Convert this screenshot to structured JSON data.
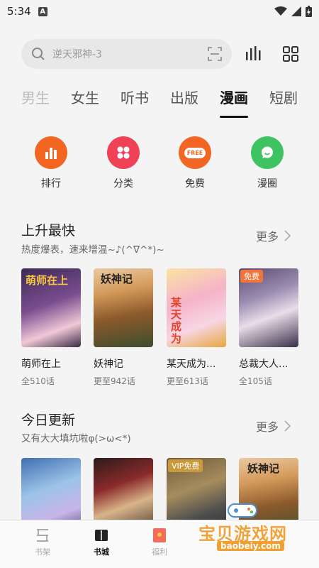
{
  "status": {
    "time": "5:34",
    "a_label": "A"
  },
  "search": {
    "placeholder": "逆天邪神-3"
  },
  "tabs": [
    {
      "label": "男生"
    },
    {
      "label": "女生"
    },
    {
      "label": "听书"
    },
    {
      "label": "出版"
    },
    {
      "label": "漫画"
    },
    {
      "label": "短剧"
    }
  ],
  "active_tab": "漫画",
  "quick_actions": [
    {
      "label": "排行",
      "icon": "bar-chart-icon",
      "color": "#f26522"
    },
    {
      "label": "分类",
      "icon": "grid-icon",
      "color": "#ef4257"
    },
    {
      "label": "免费",
      "icon": "free-icon",
      "icon_text": "FREE",
      "color": "#f26522"
    },
    {
      "label": "漫圈",
      "icon": "chat-icon",
      "color": "#3ec362"
    }
  ],
  "sections": [
    {
      "title": "上升最快",
      "subtitle": "热度爆表，速来增温~♪(^∇^*)~",
      "more": "更多",
      "books": [
        {
          "title": "萌师在上",
          "meta": "全510话",
          "cover_text": "萌师在上",
          "badge": ""
        },
        {
          "title": "妖神记",
          "meta": "更至942话",
          "cover_text": "妖神记",
          "badge": ""
        },
        {
          "title": "某天成为...",
          "meta": "更至613话",
          "cover_text": "某天成为",
          "badge": ""
        },
        {
          "title": "总裁大人...",
          "meta": "全105话",
          "cover_text": "",
          "badge": "免费"
        }
      ]
    },
    {
      "title": "今日更新",
      "subtitle": "又有大大填坑啦φ(>ω<*)",
      "more": "更多",
      "books": [
        {
          "title": "",
          "meta": "",
          "cover_text": "",
          "badge": ""
        },
        {
          "title": "",
          "meta": "",
          "cover_text": "",
          "badge": ""
        },
        {
          "title": "",
          "meta": "",
          "cover_text": "",
          "badge": "VIP免费"
        },
        {
          "title": "",
          "meta": "",
          "cover_text": "妖神记",
          "badge": ""
        }
      ]
    }
  ],
  "bottom_nav": [
    {
      "label": "书架",
      "icon": "bookshelf-icon"
    },
    {
      "label": "书城",
      "icon": "book-store-icon",
      "active": true
    },
    {
      "label": "福利",
      "icon": "red-envelope-icon"
    },
    {
      "label": "",
      "icon": ""
    },
    {
      "label": "",
      "icon": ""
    }
  ],
  "watermark": {
    "text": "宝贝游戏网",
    "url": "baobeiy.com"
  }
}
